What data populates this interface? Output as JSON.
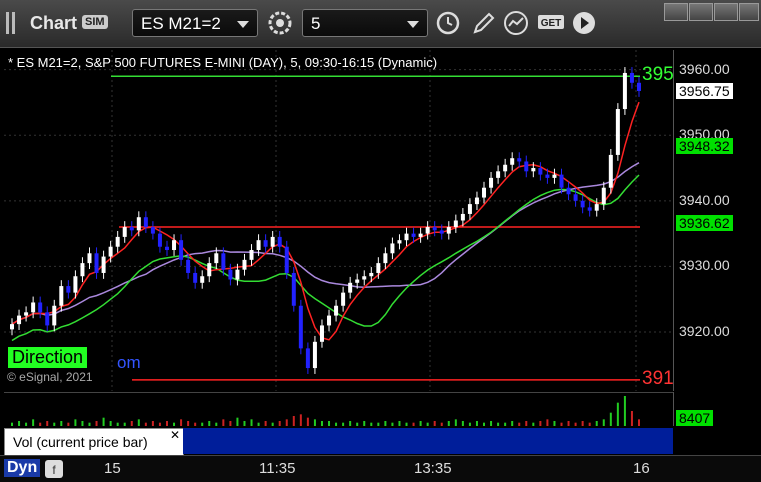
{
  "toolbar": {
    "app_label": "Chart",
    "sim_badge": "SIM",
    "symbol": "ES M21=2",
    "interval": "5",
    "icons": [
      "clock-icon",
      "pencil-icon",
      "study-icon",
      "get-icon",
      "play-icon"
    ]
  },
  "window_buttons": [
    "restore-icon",
    "minimize-icon",
    "maximize-icon",
    "close-icon"
  ],
  "chart_data": {
    "type": "candlestick",
    "title": "* ES M21=2, S&P 500 FUTURES E-MINI (DAY), 5, 09:30-16:15 (Dynamic)",
    "ylim": [
      3911,
      3963
    ],
    "y_ticks": [
      "3960.00",
      "3950.00",
      "3940.00",
      "3930.00",
      "3920.00"
    ],
    "x_ticks": [
      "15",
      "11:35",
      "13:35",
      "16"
    ],
    "price_tags": [
      {
        "label": "3956.75",
        "value": 3956.75,
        "bg": "#ffffff",
        "fg": "#000000"
      },
      {
        "label": "3948.32",
        "value": 3948.32,
        "bg": "#00e000",
        "fg": "#000000"
      },
      {
        "label": "3936.62",
        "value": 3936.62,
        "bg": "#00e000",
        "fg": "#000000"
      }
    ],
    "level_labels": [
      {
        "text": "395",
        "value": 3959.0,
        "color": "#33ff33"
      },
      {
        "text": "391",
        "value": 3912.7,
        "color": "#ff3333"
      }
    ],
    "annotations": {
      "direction": "Direction",
      "om_fragment": "om",
      "copyright": "© eSignal, 2021"
    },
    "colors": {
      "up": "#ffffff",
      "down": "#2222ff",
      "green_level": "#33dd33",
      "red_level": "#ff2222",
      "purple": "#aa88dd",
      "red_ma": "#ff2222",
      "green_ma": "#33dd33"
    },
    "close_series": [
      3921.2,
      3922.5,
      3923.0,
      3924.5,
      3923.0,
      3921.0,
      3924.0,
      3927.0,
      3926.0,
      3928.5,
      3930.5,
      3932.0,
      3929.0,
      3931.5,
      3933.0,
      3934.5,
      3936.0,
      3935.5,
      3937.5,
      3936.0,
      3935.0,
      3933.0,
      3932.5,
      3934.0,
      3931.0,
      3929.0,
      3927.5,
      3928.5,
      3930.5,
      3932.0,
      3929.5,
      3928.0,
      3929.5,
      3931.0,
      3932.5,
      3934.0,
      3933.0,
      3934.5,
      3933.0,
      3929.0,
      3924.0,
      3917.5,
      3914.5,
      3918.5,
      3921.0,
      3922.5,
      3924.0,
      3926.0,
      3927.5,
      3928.0,
      3928.5,
      3929.0,
      3930.5,
      3932.0,
      3933.5,
      3934.0,
      3935.0,
      3934.5,
      3935.0,
      3936.0,
      3935.5,
      3935.0,
      3936.0,
      3937.0,
      3938.0,
      3939.5,
      3940.5,
      3942.0,
      3943.5,
      3944.5,
      3945.5,
      3946.5,
      3946.0,
      3944.5,
      3945.0,
      3944.0,
      3943.5,
      3944.0,
      3942.0,
      3941.0,
      3940.0,
      3939.0,
      3938.5,
      3939.5,
      3942.0,
      3947.0,
      3954.0,
      3959.5,
      3958.0,
      3956.75
    ],
    "green_level": 3959.0,
    "red_level": 3936.0,
    "support_level": 3912.7,
    "volume": [
      2,
      3,
      2,
      4,
      2,
      3,
      2,
      3,
      2,
      4,
      3,
      2,
      3,
      5,
      3,
      2,
      2,
      3,
      4,
      2,
      3,
      2,
      3,
      2,
      4,
      3,
      2,
      2,
      3,
      2,
      4,
      3,
      5,
      3,
      4,
      2,
      3,
      2,
      3,
      4,
      6,
      7,
      5,
      4,
      3,
      3,
      2,
      2,
      3,
      2,
      3,
      2,
      2,
      3,
      2,
      3,
      2,
      2,
      3,
      2,
      3,
      2,
      3,
      4,
      3,
      2,
      3,
      2,
      3,
      2,
      2,
      3,
      2,
      3,
      2,
      3,
      4,
      3,
      2,
      3,
      2,
      3,
      2,
      3,
      4,
      8,
      14,
      18,
      9,
      4
    ],
    "volume_label": "8407",
    "volume_study": "Vol (current price bar)"
  },
  "footer": {
    "dyn_label": "Dyn"
  }
}
